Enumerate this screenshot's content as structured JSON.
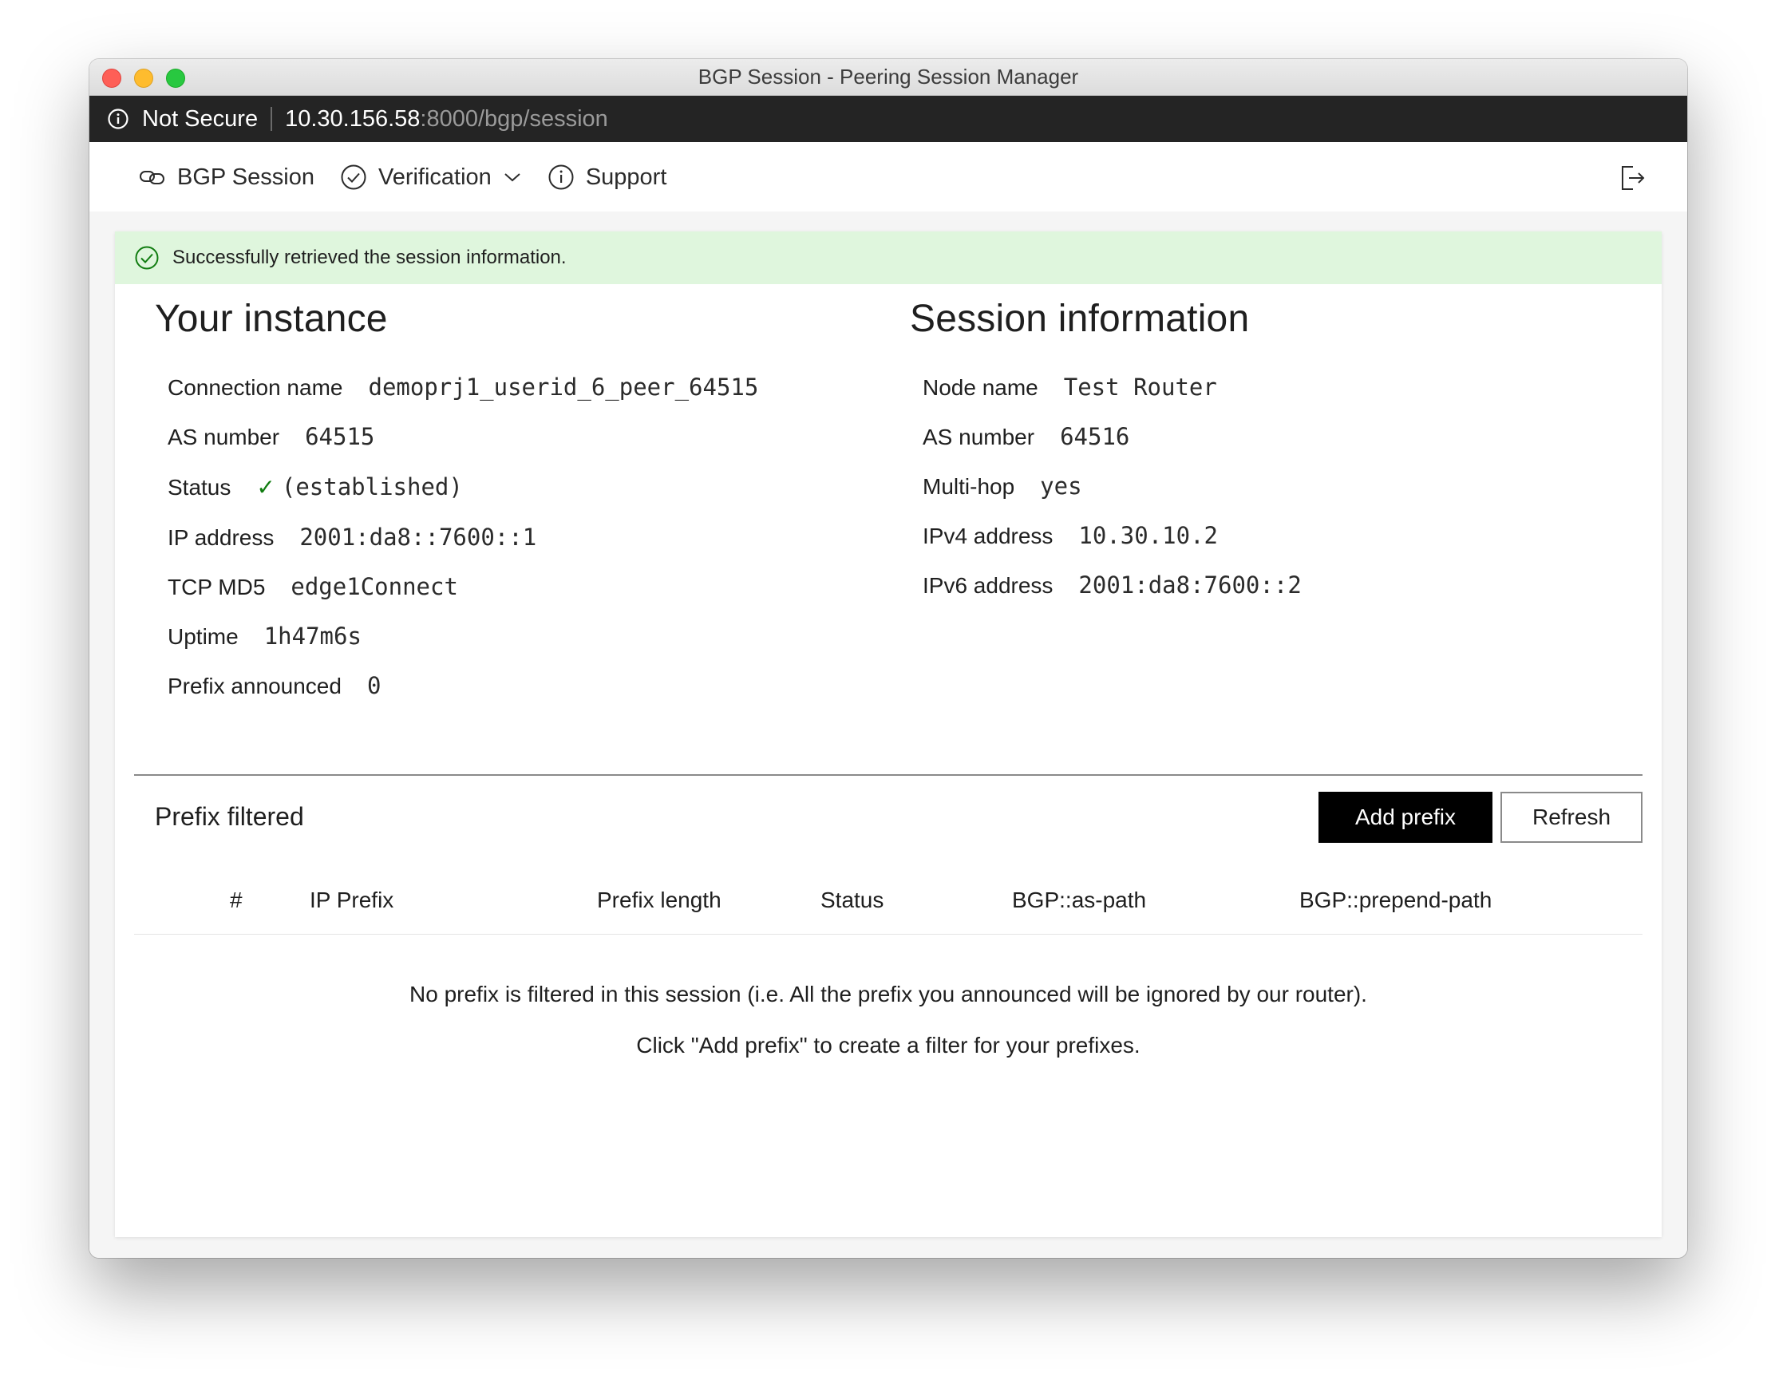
{
  "window": {
    "title": "BGP Session - Peering Session Manager"
  },
  "urlbar": {
    "security_label": "Not Secure",
    "host": "10.30.156.58",
    "path": ":8000/bgp/session"
  },
  "nav": {
    "items": [
      {
        "label": "BGP Session",
        "icon": "link-icon"
      },
      {
        "label": "Verification",
        "icon": "check-circle-icon"
      },
      {
        "label": "Support",
        "icon": "info-icon"
      }
    ],
    "logout_icon": "sign-out-icon"
  },
  "alert": {
    "message": "Successfully retrieved the session information.",
    "color": "#dff6dd"
  },
  "instance": {
    "title": "Your instance",
    "fields": [
      {
        "label": "Connection name",
        "value": "demoprj1_userid_6_peer_64515"
      },
      {
        "label": "AS number",
        "value": "64515"
      },
      {
        "label": "Status",
        "value": "(established)"
      },
      {
        "label": "IP address",
        "value": "2001:da8::7600::1"
      },
      {
        "label": "TCP MD5",
        "value": "edge1Connect"
      },
      {
        "label": "Uptime",
        "value": "1h47m6s"
      },
      {
        "label": "Prefix announced",
        "value": "0"
      }
    ]
  },
  "session": {
    "title": "Session information",
    "fields": [
      {
        "label": "Node name",
        "value": "Test Router"
      },
      {
        "label": "AS number",
        "value": "64516"
      },
      {
        "label": "Multi-hop",
        "value": "yes"
      },
      {
        "label": "IPv4 address",
        "value": "10.30.10.2"
      },
      {
        "label": "IPv6 address",
        "value": "2001:da8:7600::2"
      }
    ]
  },
  "prefix_filtered": {
    "title": "Prefix filtered",
    "add_label": "Add prefix",
    "refresh_label": "Refresh",
    "columns": [
      "#",
      "IP Prefix",
      "Prefix length",
      "Status",
      "BGP::as-path",
      "BGP::prepend-path"
    ],
    "empty_line_1": "No prefix is filtered in this session (i.e. All the prefix you announced will be ignored by our router).",
    "empty_line_2": "Click \"Add prefix\" to create a filter for your prefixes."
  },
  "colors": {
    "success": "#107c10",
    "primary_button": "#000000",
    "urlbar": "#242424"
  }
}
